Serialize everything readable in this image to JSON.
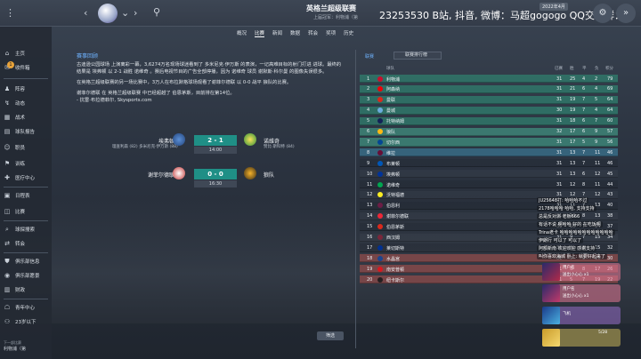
{
  "topbar": {
    "title": "英格兰超级联赛",
    "subtitle": "上届冠军：利物浦（第",
    "stream_text": "23253530 B站, 抖音, 微博：马超gogogo QQ交流群：4",
    "date": "2022年4月"
  },
  "nav": {
    "items": [
      {
        "label": "概况",
        "active": false
      },
      {
        "label": "比赛",
        "active": true
      },
      {
        "label": "新闻",
        "active": false
      },
      {
        "label": "数据",
        "active": false
      },
      {
        "label": "转会",
        "active": false
      },
      {
        "label": "奖项",
        "active": false
      },
      {
        "label": "历史",
        "active": false
      }
    ]
  },
  "sidebar": {
    "items": [
      {
        "label": "主页",
        "icon": "home-icon"
      },
      {
        "label": "收件箱",
        "icon": "inbox-icon"
      },
      {
        "label": "阵容",
        "icon": "squad-icon"
      },
      {
        "label": "动态",
        "icon": "dynamics-icon"
      },
      {
        "label": "战术",
        "icon": "tactics-icon"
      },
      {
        "label": "球队报告",
        "icon": "report-icon"
      },
      {
        "label": "职员",
        "icon": "staff-icon"
      },
      {
        "label": "训练",
        "icon": "training-icon"
      },
      {
        "label": "医疗中心",
        "icon": "medical-icon"
      },
      {
        "label": "日程表",
        "icon": "calendar-icon"
      },
      {
        "label": "比赛",
        "icon": "match-icon"
      },
      {
        "label": "球探搜索",
        "icon": "scouting-icon"
      },
      {
        "label": "转会",
        "icon": "transfer-icon"
      },
      {
        "label": "俱乐部信息",
        "icon": "club-info-icon"
      },
      {
        "label": "俱乐部愿景",
        "icon": "club-vision-icon"
      },
      {
        "label": "财政",
        "icon": "finance-icon"
      },
      {
        "label": "青年中心",
        "icon": "youth-icon"
      },
      {
        "label": "23岁以下",
        "icon": "u23-icon"
      }
    ],
    "inbox_count": "1",
    "profile_label": "利物浦（第",
    "profile_sub": "下一部比赛"
  },
  "news": {
    "tag": "赛事回顾",
    "paragraphs": [
      "古迪逊公园球场 上演离彩一幕，3,6274万名现场球迷看到了 多米尼克·伊万斯 的表演，一记高难目标的射门打进 进球。最终的结果是 埃弗顿 以 2-1 战胜 诺维奇 。赛后电视节目的广告全部停播，因为 诺维奇 球员 谢默斯·科尔曼 的图像失误很多。",
      "在英格兰超级联赛的另一场比赛中，3万人在布拉默格球场观看了谢菲尔德联 以 0-0 战平 狼队的比赛。",
      "谢菲尔德联 在 英格兰超级联赛 中已经超越了 伯恩茅斯，目前排在第14位。",
      "- 抗雷·布拉德菲尔, Skysports.com"
    ]
  },
  "matches": [
    {
      "home": "埃弗顿",
      "away": "诺维奇",
      "score": "2 - 1",
      "time": "14:00",
      "home_scorers": "理查利森 (82)\n多米尼克·伊万斯 (88)",
      "away_scorers": "赞比·斯科特 (84)"
    },
    {
      "home": "谢菲尔德联",
      "away": "狼队",
      "score": "0 - 0",
      "time": "16:30",
      "home_scorers": "",
      "away_scorers": ""
    }
  ],
  "filter_label": "筛选",
  "table": {
    "top_link": "联赛",
    "dropdown": "联赛排行榜",
    "headers": {
      "pos": "",
      "team": "球队",
      "played": "已赛",
      "won": "胜",
      "drawn": "平",
      "lost": "负",
      "pts": "积分"
    },
    "rows": [
      {
        "pos": "1",
        "team": "利物浦",
        "played": "31",
        "won": "25",
        "drawn": "4",
        "lost": "2",
        "pts": "79",
        "zone": "cl"
      },
      {
        "pos": "2",
        "team": "阿森纳",
        "played": "31",
        "won": "21",
        "drawn": "6",
        "lost": "4",
        "pts": "69",
        "zone": "cl"
      },
      {
        "pos": "3",
        "team": "曼联",
        "played": "31",
        "won": "19",
        "drawn": "7",
        "lost": "5",
        "pts": "64",
        "zone": "cl"
      },
      {
        "pos": "4",
        "team": "曼城",
        "played": "30",
        "won": "19",
        "drawn": "7",
        "lost": "4",
        "pts": "64",
        "zone": "cl"
      },
      {
        "pos": "5",
        "team": "托特纳姆",
        "played": "31",
        "won": "18",
        "drawn": "6",
        "lost": "7",
        "pts": "60",
        "zone": "cl"
      },
      {
        "pos": "6",
        "team": "狼队",
        "played": "32",
        "won": "17",
        "drawn": "6",
        "lost": "9",
        "pts": "57",
        "zone": "el"
      },
      {
        "pos": "7",
        "team": "切尔西",
        "played": "31",
        "won": "17",
        "drawn": "5",
        "lost": "9",
        "pts": "56",
        "zone": "el"
      },
      {
        "pos": "8",
        "team": "维拉",
        "played": "31",
        "won": "13",
        "drawn": "7",
        "lost": "11",
        "pts": "46",
        "zone": "ecl"
      },
      {
        "pos": "9",
        "team": "布莱顿",
        "played": "31",
        "won": "13",
        "drawn": "7",
        "lost": "11",
        "pts": "46",
        "zone": ""
      },
      {
        "pos": "10",
        "team": "埃弗顿",
        "played": "31",
        "won": "13",
        "drawn": "6",
        "lost": "12",
        "pts": "45",
        "zone": ""
      },
      {
        "pos": "11",
        "team": "诺维奇",
        "played": "31",
        "won": "12",
        "drawn": "8",
        "lost": "11",
        "pts": "44",
        "zone": ""
      },
      {
        "pos": "12",
        "team": "沃特福德",
        "played": "31",
        "won": "12",
        "drawn": "7",
        "lost": "12",
        "pts": "43",
        "zone": ""
      },
      {
        "pos": "13",
        "team": "伯恩利",
        "played": "31",
        "won": "11",
        "drawn": "7",
        "lost": "13",
        "pts": "40",
        "zone": ""
      },
      {
        "pos": "14",
        "team": "谢菲尔德联",
        "played": "31",
        "won": "10",
        "drawn": "8",
        "lost": "13",
        "pts": "38",
        "zone": ""
      },
      {
        "pos": "15",
        "team": "伯恩茅斯",
        "played": "31",
        "won": "10",
        "drawn": "7",
        "lost": "14",
        "pts": "37",
        "zone": ""
      },
      {
        "pos": "16",
        "team": "西汉姆",
        "played": "31",
        "won": "9",
        "drawn": "7",
        "lost": "15",
        "pts": "34",
        "zone": ""
      },
      {
        "pos": "17",
        "team": "莱切斯特",
        "played": "31",
        "won": "8",
        "drawn": "8",
        "lost": "15",
        "pts": "32",
        "zone": ""
      },
      {
        "pos": "18",
        "team": "水晶宫",
        "played": "31",
        "won": "7",
        "drawn": "9",
        "lost": "15",
        "pts": "30",
        "zone": "rel"
      },
      {
        "pos": "19",
        "team": "南安普顿",
        "played": "31",
        "won": "6",
        "drawn": "8",
        "lost": "17",
        "pts": "26",
        "zone": "rel"
      },
      {
        "pos": "20",
        "team": "纽卡斯尔",
        "played": "31",
        "won": "5",
        "drawn": "7",
        "lost": "19",
        "pts": "22",
        "zone": "rel"
      }
    ]
  },
  "chat": [
    "JU25648打: 哈哈哈不过",
    "2178哈哈哈 哈哈, 支持支持",
    "总是反对派 老板666",
    "有话不说 啊哈哈 好的 在吃饭啊",
    "Trina老卡 哈哈哈哈哈哈哈哈哈哈哈哈",
    "伊朗行 可以了 可以了",
    "阿额新南 欢迎欢迎 感谢支持",
    "叫你喜欢海城 卧上: 就要好起来了"
  ],
  "gifts": [
    {
      "name": "用户名",
      "text": "送出小心心 x1"
    },
    {
      "name": "用户名",
      "text": "送出小心心 x1"
    },
    {
      "name": "飞机",
      "text": ""
    },
    {
      "name": "",
      "text": "5/28"
    }
  ],
  "colors": {
    "accent_blue": "#6fb3ff",
    "score_green": "#1f8f86",
    "zone_cl": "#2f7a6c",
    "zone_el": "#3f8a7a",
    "zone_ecl": "#3a6f8a",
    "zone_rel": "#8a4a4a"
  }
}
